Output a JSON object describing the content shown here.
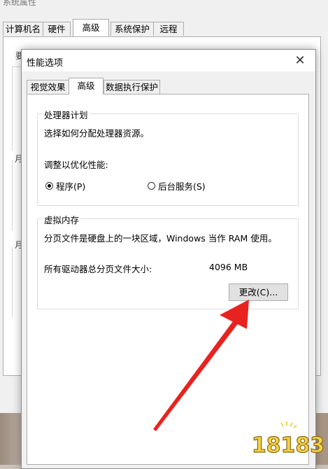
{
  "background_window": {
    "title": "系统属性",
    "tabs": [
      {
        "label": "计算机名",
        "selected": false
      },
      {
        "label": "硬件",
        "selected": false
      },
      {
        "label": "高级",
        "selected": true
      },
      {
        "label": "系统保护",
        "selected": false
      },
      {
        "label": "远程",
        "selected": false
      }
    ],
    "fragments": [
      "要",
      "月",
      "月"
    ]
  },
  "dialog": {
    "title": "性能选项",
    "close_glyph": "✕",
    "tabs": [
      {
        "label": "视觉效果",
        "selected": false
      },
      {
        "label": "高级",
        "selected": true
      },
      {
        "label": "数据执行保护",
        "selected": false
      }
    ],
    "processor_group": {
      "title": "处理器计划",
      "description": "选择如何分配处理器资源。",
      "adjust_label": "调整以优化性能:",
      "options": [
        {
          "label": "程序(P)",
          "checked": true
        },
        {
          "label": "后台服务(S)",
          "checked": false
        }
      ]
    },
    "virtual_memory_group": {
      "title": "虚拟内存",
      "description": "分页文件是硬盘上的一块区域，Windows 当作 RAM 使用。",
      "total_label": "所有驱动器总分页文件大小:",
      "total_value": "4096 MB",
      "change_button": "更改(C)..."
    }
  },
  "watermark": {
    "text": "18183"
  },
  "colors": {
    "arrow": "#e8231f",
    "watermark": "#f4d04a"
  }
}
